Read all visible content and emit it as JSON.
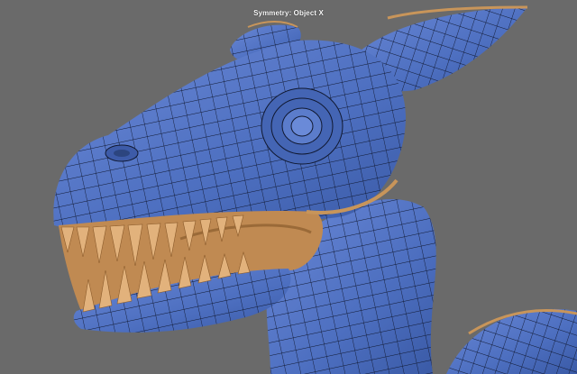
{
  "viewport": {
    "overlay_text": "Symmetry: Object X",
    "background_color": "#6a6a6a",
    "mesh_color": "#4f72c0",
    "mesh_dark": "#37549a",
    "wire_color": "#111a33",
    "mouth_color": "#c8955a",
    "teeth_color": "#e2b27c",
    "model": "creature-head-wireframe"
  }
}
